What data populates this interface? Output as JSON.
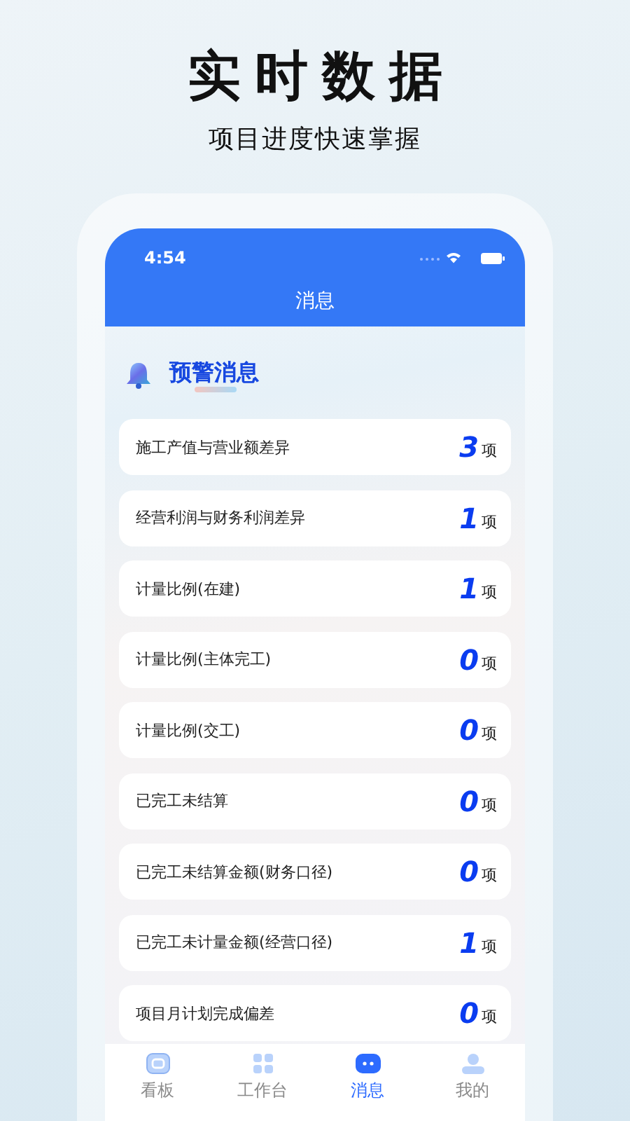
{
  "headline": "实时数据",
  "subtitle": "项目进度快速掌握",
  "status_bar": {
    "time": "4:54"
  },
  "nav": {
    "title": "消息"
  },
  "section": {
    "title": "预警消息"
  },
  "alerts": [
    {
      "label": "施工产值与营业额差异",
      "count": "3",
      "unit": "项"
    },
    {
      "label": "经营利润与财务利润差异",
      "count": "1",
      "unit": "项"
    },
    {
      "label": "计量比例(在建)",
      "count": "1",
      "unit": "项"
    },
    {
      "label": "计量比例(主体完工)",
      "count": "0",
      "unit": "项"
    },
    {
      "label": "计量比例(交工)",
      "count": "0",
      "unit": "项"
    },
    {
      "label": "已完工未结算",
      "count": "0",
      "unit": "项"
    },
    {
      "label": "已完工未结算金额(财务口径)",
      "count": "0",
      "unit": "项"
    },
    {
      "label": "已完工未计量金额(经营口径)",
      "count": "1",
      "unit": "项"
    },
    {
      "label": "项目月计划完成偏差",
      "count": "0",
      "unit": "项"
    }
  ],
  "tabs": [
    {
      "label": "看板",
      "kind": "board",
      "selected": false
    },
    {
      "label": "工作台",
      "kind": "grid",
      "selected": false
    },
    {
      "label": "消息",
      "kind": "chat",
      "selected": true
    },
    {
      "label": "我的",
      "kind": "user",
      "selected": false
    }
  ]
}
